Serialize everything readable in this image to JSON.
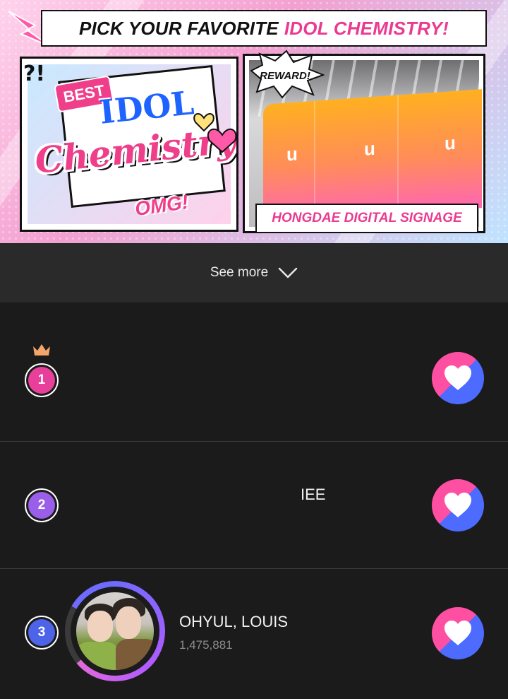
{
  "banner": {
    "title_part1": "PICK YOUR FAVORITE",
    "title_part2": "IDOL CHEMISTRY!",
    "question_mark": "?!",
    "best_label": "BEST",
    "idol_label": "IDOL",
    "chemistry_label": "Chemistry",
    "omg_label": "OMG!",
    "reward_label": "REWARD!",
    "signage_label": "HONGDAE DIGITAL SIGNAGE",
    "screen_logo": "u"
  },
  "see_more": {
    "label": "See more"
  },
  "ranking": [
    {
      "rank": "1",
      "name": "",
      "votes": "",
      "badge_color": "#e8409a"
    },
    {
      "rank": "2",
      "name": "IEE",
      "votes": "",
      "badge_color": "#9a5ee8"
    },
    {
      "rank": "3",
      "name": "OHYUL, LOUIS",
      "votes": "1,475,881",
      "badge_color": "#4d63e8"
    }
  ],
  "colors": {
    "vote_pink": "#ff4fa3",
    "vote_blue": "#4d6bff",
    "crown": "#f4a66a"
  },
  "icons": {
    "vote": "heart-icon",
    "see_more": "chevron-down-icon",
    "rank1_decoration": "crown-icon"
  }
}
